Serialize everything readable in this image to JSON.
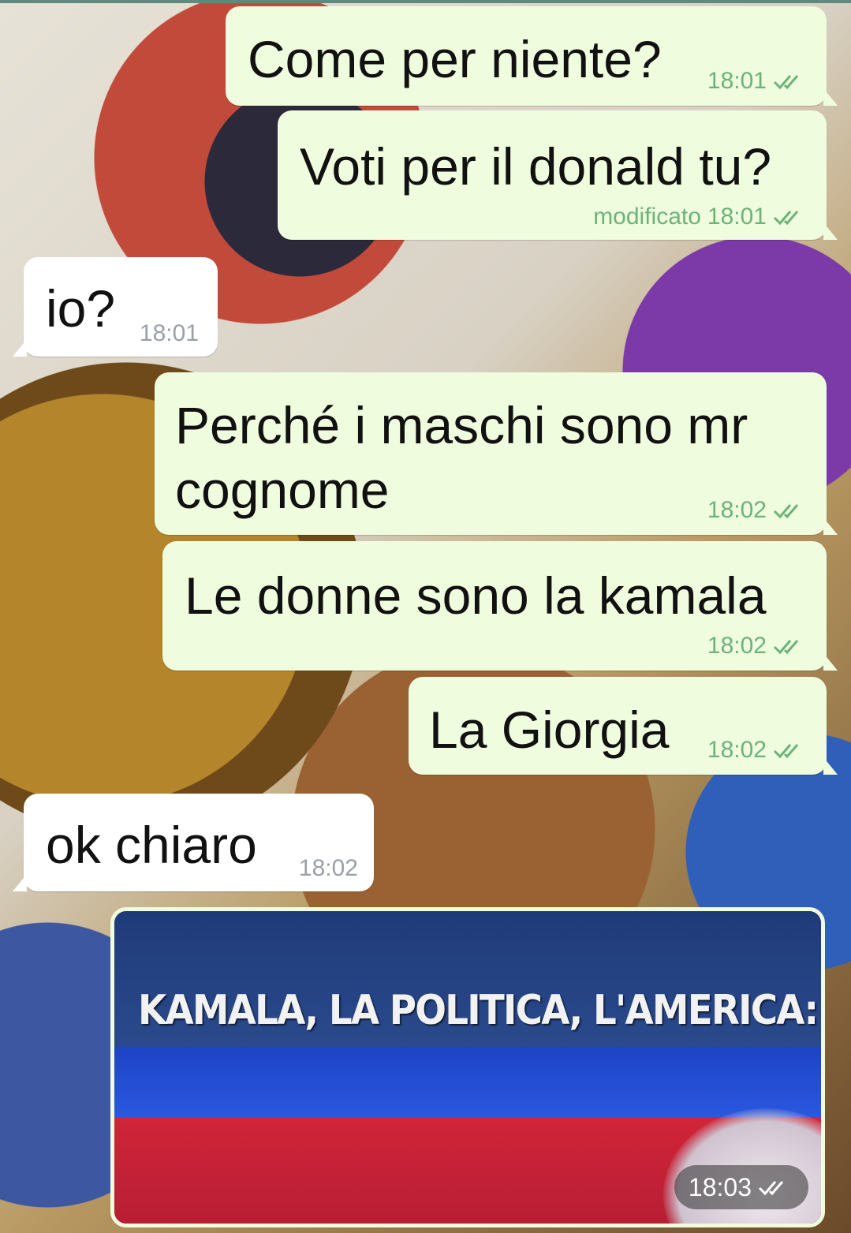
{
  "colors": {
    "outgoing_bubble": "#effdde",
    "incoming_bubble": "#ffffff",
    "read_ticks": "#6cb37a",
    "incoming_time": "#9aa0a6"
  },
  "messages": [
    {
      "direction": "outgoing",
      "text": "Come per niente?",
      "time": "18:01",
      "edited_label": "",
      "status_icon": "double-check-icon"
    },
    {
      "direction": "outgoing",
      "text": "Voti per il donald tu?",
      "time": "18:01",
      "edited_label": "modificato",
      "status_icon": "double-check-icon"
    },
    {
      "direction": "incoming",
      "text": "io?",
      "time": "18:01"
    },
    {
      "direction": "outgoing",
      "text": "Perché i maschi sono mr\ncognome",
      "time": "18:02",
      "edited_label": "",
      "status_icon": "double-check-icon"
    },
    {
      "direction": "outgoing",
      "text": "Le donne sono la kamala",
      "time": "18:02",
      "edited_label": "",
      "status_icon": "double-check-icon"
    },
    {
      "direction": "outgoing",
      "text": "La Giorgia",
      "time": "18:02",
      "edited_label": "",
      "status_icon": "double-check-icon"
    },
    {
      "direction": "incoming",
      "text": "ok chiaro",
      "time": "18:02"
    }
  ],
  "media_message": {
    "caption_in_image": "KAMALA, LA POLITICA, L'AMERICA:",
    "time": "18:03",
    "status_icon": "double-check-icon"
  }
}
